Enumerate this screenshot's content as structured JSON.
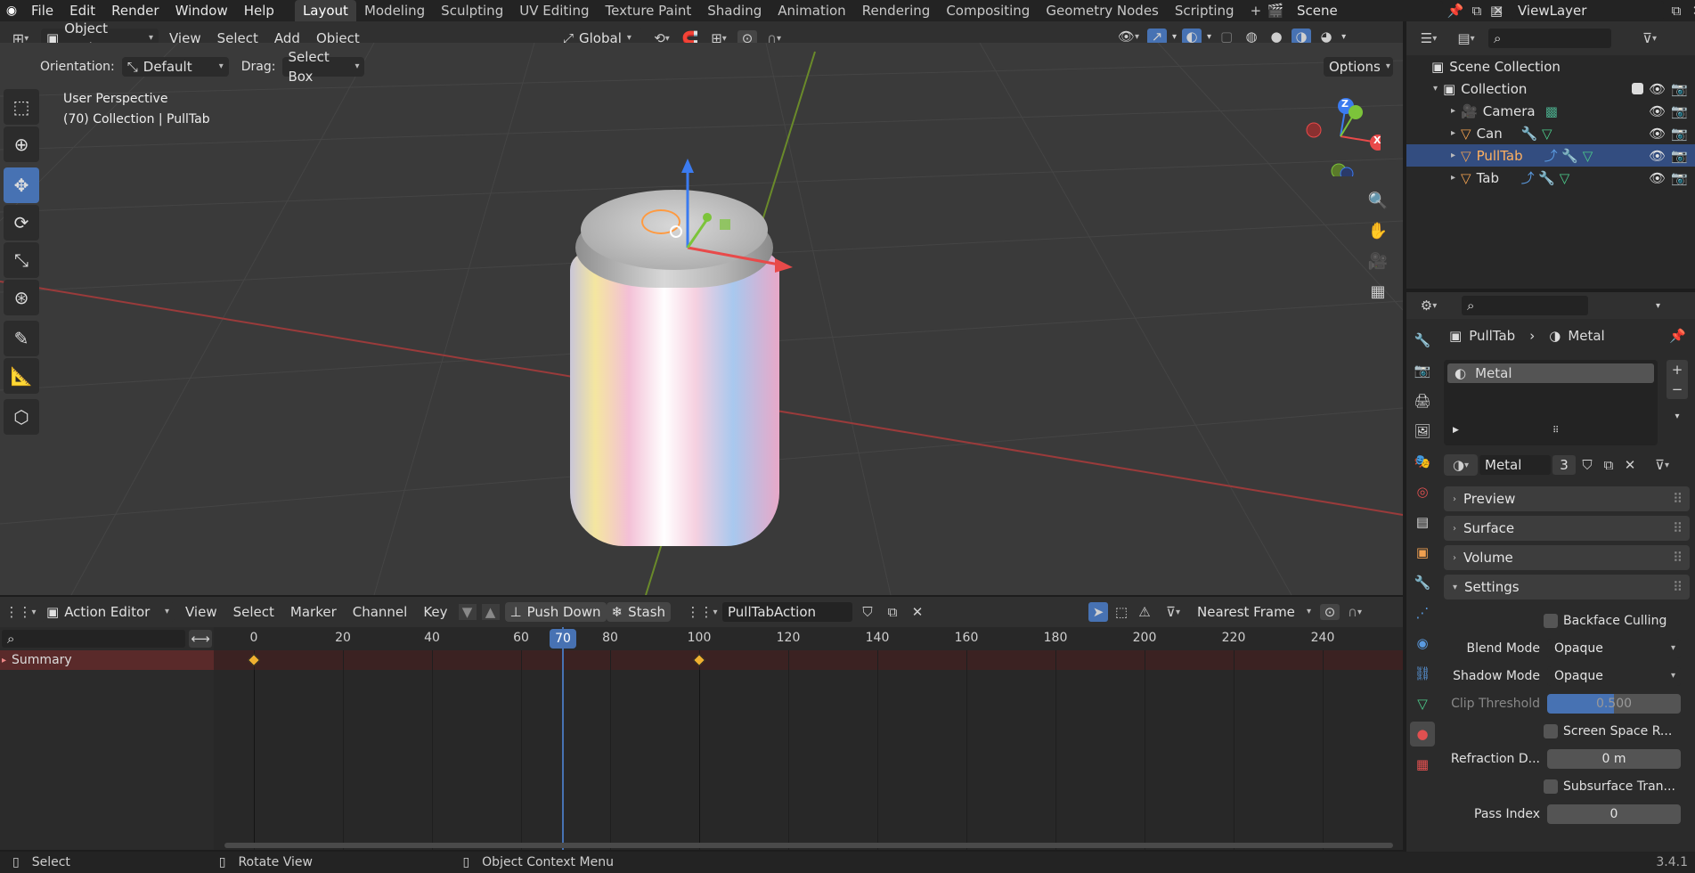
{
  "topbar": {
    "menus": [
      "File",
      "Edit",
      "Render",
      "Window",
      "Help"
    ],
    "workspaces": [
      "Layout",
      "Modeling",
      "Sculpting",
      "UV Editing",
      "Texture Paint",
      "Shading",
      "Animation",
      "Rendering",
      "Compositing",
      "Geometry Nodes",
      "Scripting"
    ],
    "active_workspace": "Layout",
    "add_tab": "+",
    "scene": "Scene",
    "view_layer": "ViewLayer"
  },
  "viewport_header": {
    "mode": "Object Mode",
    "menus": [
      "View",
      "Select",
      "Add",
      "Object"
    ],
    "transform_orientation": "Global",
    "orientation_label": "Orientation:",
    "orientation_value": "Default",
    "drag_label": "Drag:",
    "drag_value": "Select Box",
    "options": "Options"
  },
  "viewport": {
    "perspective": "User Perspective",
    "info": "(70) Collection | PullTab",
    "gizmo_axes": [
      "Z",
      "Y",
      "X"
    ]
  },
  "outliner": {
    "root": "Scene Collection",
    "collection": "Collection",
    "items": [
      {
        "name": "Camera",
        "selected": false
      },
      {
        "name": "Can",
        "selected": false
      },
      {
        "name": "PullTab",
        "selected": true
      },
      {
        "name": "Tab",
        "selected": false
      }
    ]
  },
  "properties": {
    "breadcrumb_object": "PullTab",
    "breadcrumb_material": "Metal",
    "slot_name": "Metal",
    "material_name": "Metal",
    "users": "3",
    "panels": [
      "Preview",
      "Surface",
      "Volume",
      "Settings"
    ],
    "settings": {
      "backface_culling": "Backface Culling",
      "blend_mode_label": "Blend Mode",
      "blend_mode": "Opaque",
      "shadow_mode_label": "Shadow Mode",
      "shadow_mode": "Opaque",
      "clip_threshold_label": "Clip Threshold",
      "clip_threshold": "0.500",
      "screen_space": "Screen Space R...",
      "refraction_label": "Refraction D...",
      "refraction": "0 m",
      "subsurface": "Subsurface Tran...",
      "pass_index_label": "Pass Index",
      "pass_index": "0"
    }
  },
  "dope_header": {
    "editor": "Action Editor",
    "menus": [
      "View",
      "Select",
      "Marker",
      "Channel",
      "Key"
    ],
    "push_down": "Push Down",
    "stash": "Stash",
    "action": "PullTabAction",
    "snapping": "Nearest Frame"
  },
  "timeline": {
    "ticks": [
      0,
      20,
      40,
      60,
      80,
      100,
      120,
      140,
      160,
      180,
      200,
      220,
      240
    ],
    "current_frame": "70",
    "channel": "Summary",
    "keyframes": [
      0,
      100
    ]
  },
  "statusbar": {
    "select": "Select",
    "rotate": "Rotate View",
    "context": "Object Context Menu",
    "version": "3.4.1"
  },
  "colors": {
    "accent": "#4772b3",
    "selected_row": "#334d80",
    "keyframe": "#f0b030",
    "summary": "#5a2a2a"
  }
}
